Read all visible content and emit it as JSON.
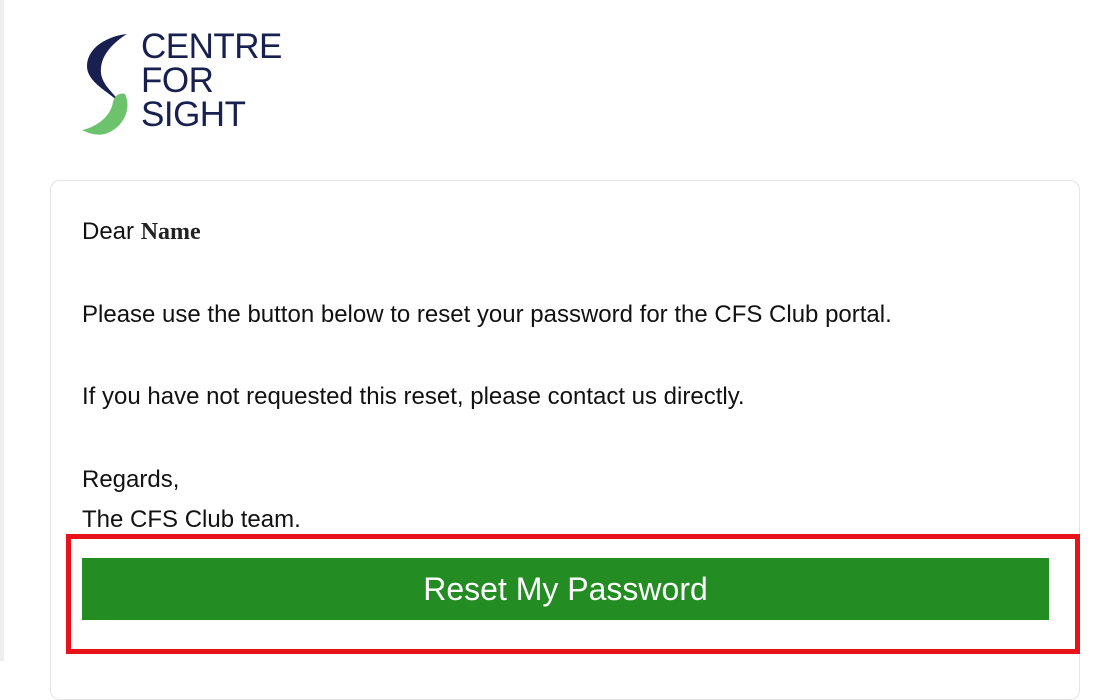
{
  "logo": {
    "line1": "CENTRE",
    "line2": "FOR",
    "line3": "SIGHT"
  },
  "email": {
    "greeting_prefix": "Dear ",
    "greeting_name": "Name",
    "line1": "Please use the button below to reset your password for the CFS Club portal.",
    "line2": "If you have not requested this reset, please contact us directly.",
    "regards": "Regards,",
    "signature": "The CFS Club team."
  },
  "button": {
    "label": "Reset My Password"
  },
  "colors": {
    "brand_navy": "#18204f",
    "brand_green": "#6cc36b",
    "button_green": "#238c23",
    "highlight_red": "#e8121a"
  },
  "icons": {
    "logo_mark": "centre-for-sight-s-mark-icon"
  }
}
